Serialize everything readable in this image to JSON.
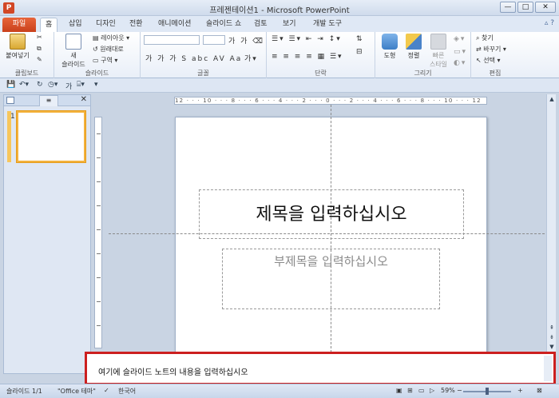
{
  "window": {
    "title": "프레젠테이션1 - Microsoft PowerPoint",
    "app_icon": "P",
    "controls": [
      "—",
      "□",
      "✕"
    ]
  },
  "ribbon_tabs": {
    "file": "파일",
    "items": [
      "홈",
      "삽입",
      "디자인",
      "전환",
      "애니메이션",
      "슬라이드 쇼",
      "검토",
      "보기",
      "개발 도구"
    ],
    "active": "홈"
  },
  "clipboard": {
    "paste": "붙여넣기",
    "label": "클립보드"
  },
  "slides_group": {
    "new_slide_line1": "새",
    "new_slide_line2": "슬라이드",
    "layout": "레이아웃",
    "reset": "원래대로",
    "section": "구역",
    "label": "슬라이드"
  },
  "font_group": {
    "format_glyphs": "가 가 가 S abc AV Aa",
    "label": "글꼴"
  },
  "paragraph_group": {
    "label": "단락"
  },
  "drawing_group": {
    "shapes": "도형",
    "arrange": "정렬",
    "quick_styles_line1": "빠른",
    "quick_styles_line2": "스타일",
    "label": "그리기"
  },
  "editing_group": {
    "find": "찾기",
    "replace": "바꾸기",
    "select": "선택",
    "label": "편집"
  },
  "slide_panel": {
    "outline_tab": "≡",
    "close": "✕",
    "thumb_number": "1"
  },
  "ruler": {
    "horizontal": "12 · · · 10 · · · 8 · · · 6 · · · 4 · · · 2 · · · 0 · · · 2 · · · 4 · · · 6 · · · 8 · · · 10 · · · 12"
  },
  "slide": {
    "title_placeholder": "제목을 입력하십시오",
    "subtitle_placeholder": "부제목을 입력하십시오"
  },
  "notes": {
    "placeholder": "여기에 슬라이드 노트의 내용을 입력하십시오"
  },
  "status": {
    "slide": "슬라이드 1/1",
    "theme": "\"Office 테마\"",
    "language": "한국어",
    "zoom": "59%"
  }
}
